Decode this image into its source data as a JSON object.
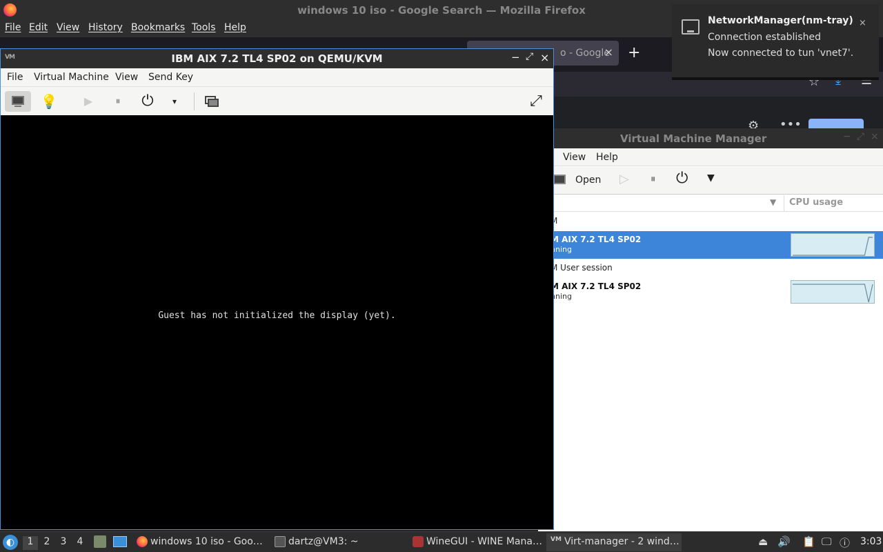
{
  "firefox": {
    "title": "windows 10 iso - Google Search — Mozilla Firefox",
    "menu": [
      "File",
      "Edit",
      "View",
      "History",
      "Bookmarks",
      "Tools",
      "Help"
    ],
    "tab_label": "o - Google",
    "tab_close": "×",
    "new_tab": "+"
  },
  "viewer": {
    "app_icon": "VM",
    "title": "IBM AIX 7.2 TL4 SP02 on QEMU/KVM",
    "menu": [
      "File",
      "Virtual Machine",
      "View",
      "Send Key"
    ],
    "console_message": "Guest has not initialized the display (yet).",
    "min": "−",
    "max": "⤢",
    "close": "×",
    "icons": {
      "details": "💡",
      "run": "▶",
      "pause": "⏸",
      "power": "⏻",
      "dropdown": "▾",
      "fullscreen": "⤢"
    }
  },
  "vmm": {
    "title": "Virtual Machine Manager",
    "menu": [
      "View",
      "Help"
    ],
    "open_label": "Open",
    "column_cpu": "CPU usage",
    "rows": [
      {
        "type": "connection",
        "label": "M"
      },
      {
        "type": "vm",
        "name": "M AIX 7.2 TL4 SP02",
        "status": "nning",
        "selected": true,
        "cpu_points": [
          0,
          0,
          0,
          0,
          0,
          0,
          0,
          0,
          0,
          0,
          0,
          0,
          0,
          0,
          0,
          0,
          0,
          0,
          0,
          1,
          1
        ]
      },
      {
        "type": "connection",
        "label": "M User session"
      },
      {
        "type": "vm",
        "name": "M AIX 7.2 TL4 SP02",
        "status": "nning",
        "selected": false,
        "cpu_points": [
          1,
          1,
          1,
          1,
          1,
          1,
          1,
          1,
          1,
          1,
          1,
          1,
          1,
          1,
          1,
          1,
          1,
          1,
          1,
          0,
          1
        ]
      }
    ]
  },
  "notification": {
    "title": "NetworkManager(nm-tray)",
    "line1": "Connection established",
    "line2": "Now connected to tun 'vnet7'.",
    "close": "×"
  },
  "taskbar": {
    "workspaces": [
      "1",
      "2",
      "3",
      "4"
    ],
    "active_workspace": "1",
    "tasks": [
      {
        "label": "windows 10 iso - Goo…",
        "icon": "firefox-icon"
      },
      {
        "label": "dartz@VM3: ~",
        "icon": "terminal-icon"
      },
      {
        "label": "WineGUI - WINE Mana…",
        "icon": "wine-icon"
      },
      {
        "label": "Virt-manager - 2 wind…",
        "icon": "virt-manager-icon"
      }
    ],
    "clock": "3:03",
    "virt_icon_text": "VM"
  }
}
